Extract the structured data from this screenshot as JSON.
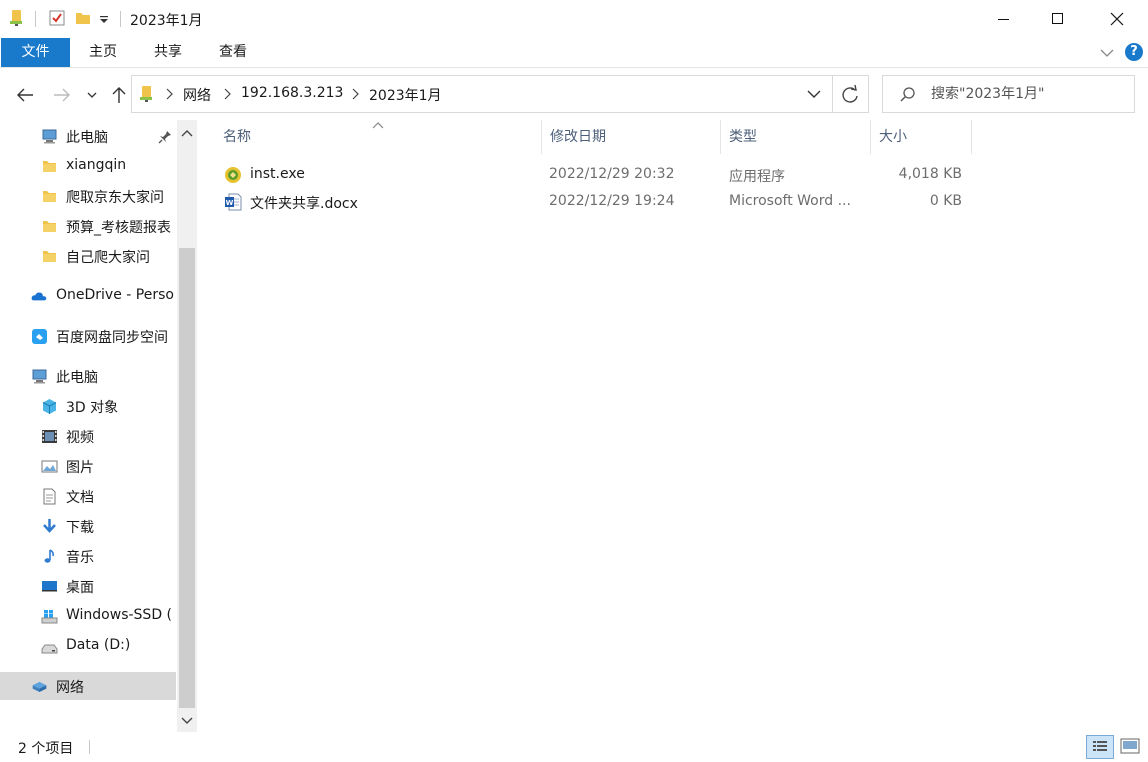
{
  "window": {
    "title": "2023年1月",
    "controls": [
      "minimize",
      "maximize",
      "close"
    ]
  },
  "ribbon": {
    "tabs": [
      {
        "id": "file",
        "label": "文件"
      },
      {
        "id": "home",
        "label": "主页"
      },
      {
        "id": "share",
        "label": "共享"
      },
      {
        "id": "view",
        "label": "查看"
      }
    ],
    "help_label": "?"
  },
  "address": {
    "crumbs": [
      "网络",
      "192.168.3.213",
      "2023年1月"
    ]
  },
  "search": {
    "placeholder": "搜索\"2023年1月\""
  },
  "sidebar": {
    "items": [
      {
        "label": "此电脑",
        "icon": "computer-icon",
        "indent": 1
      },
      {
        "label": "xiangqin",
        "icon": "folder-icon",
        "indent": 2
      },
      {
        "label": "爬取京东大家问",
        "icon": "folder-icon",
        "indent": 2
      },
      {
        "label": "预算_考核题报表",
        "icon": "folder-icon",
        "indent": 2
      },
      {
        "label": "自己爬大家问",
        "icon": "folder-icon",
        "indent": 2
      },
      {
        "label": "OneDrive - Perso",
        "icon": "onedrive-icon",
        "indent": 0
      },
      {
        "label": "百度网盘同步空间",
        "icon": "baidu-netdisk-icon",
        "indent": 0
      },
      {
        "label": "此电脑",
        "icon": "computer-icon",
        "indent": 0
      },
      {
        "label": "3D 对象",
        "icon": "cube-3d-icon",
        "indent": 1
      },
      {
        "label": "视频",
        "icon": "video-icon",
        "indent": 1
      },
      {
        "label": "图片",
        "icon": "pictures-icon",
        "indent": 1
      },
      {
        "label": "文档",
        "icon": "documents-icon",
        "indent": 1
      },
      {
        "label": "下载",
        "icon": "download-icon",
        "indent": 1
      },
      {
        "label": "音乐",
        "icon": "music-icon",
        "indent": 1
      },
      {
        "label": "桌面",
        "icon": "desktop-icon",
        "indent": 1
      },
      {
        "label": "Windows-SSD (",
        "icon": "windows-drive-icon",
        "indent": 1
      },
      {
        "label": "Data (D:)",
        "icon": "drive-icon",
        "indent": 1
      },
      {
        "label": "网络",
        "icon": "network-icon",
        "indent": 0,
        "selected": true
      }
    ]
  },
  "columns": {
    "name": "名称",
    "date": "修改日期",
    "type": "类型",
    "size": "大小"
  },
  "files": [
    {
      "name": "inst.exe",
      "date": "2022/12/29 20:32",
      "type": "应用程序",
      "size": "4,018 KB",
      "icon": "exe-icon"
    },
    {
      "name": "文件夹共享.docx",
      "date": "2022/12/29 19:24",
      "type": "Microsoft Word ...",
      "size": "0 KB",
      "icon": "word-doc-icon"
    }
  ],
  "status": {
    "count": "2 个项目"
  },
  "colors": {
    "accent": "#1979ca",
    "selected_bg": "#d9d9d9",
    "header_text": "#4c607a",
    "folder_yellow": "#f0c44a"
  }
}
